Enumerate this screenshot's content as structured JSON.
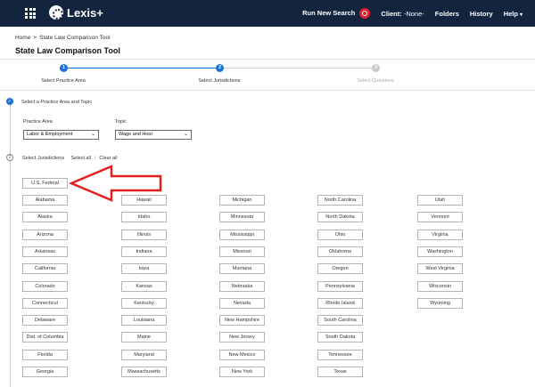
{
  "header": {
    "logo_text": "Lexis+",
    "run_search": "Run New Search",
    "client_label": "Client:",
    "client_value": "-None-",
    "folders": "Folders",
    "history": "History",
    "help": "Help"
  },
  "breadcrumb": {
    "home": "Home",
    "sep": ">",
    "current": "State Law Comparison Tool"
  },
  "page_title": "State Law Comparison Tool",
  "steps": [
    {
      "num": "1",
      "label": "Select Practice Area"
    },
    {
      "num": "2",
      "label": "Select Jurisdictions"
    },
    {
      "num": "3",
      "label": "Select Questions"
    }
  ],
  "section1": {
    "label": "Select a Practice Area and Topic",
    "practice_area_label": "Practice Area",
    "practice_area_value": "Labor & Employment",
    "topic_label": "Topic",
    "topic_value": "Wage and Hour"
  },
  "section2": {
    "label": "Select Jurisdictions",
    "select_all": "Select all",
    "pipe": "|",
    "clear_all": "Clear all",
    "num": "2"
  },
  "federal": "U.S. Federal",
  "columns": [
    [
      "Alabama",
      "Alaska",
      "Arizona",
      "Arkansas",
      "California",
      "Colorado",
      "Connecticut",
      "Delaware",
      "Dist. of Columbia",
      "Florida",
      "Georgia"
    ],
    [
      "Hawaii",
      "Idaho",
      "Illinois",
      "Indiana",
      "Iowa",
      "Kansas",
      "Kentucky",
      "Louisiana",
      "Maine",
      "Maryland",
      "Massachusetts"
    ],
    [
      "Michigan",
      "Minnesota",
      "Mississippi",
      "Missouri",
      "Montana",
      "Nebraska",
      "Nevada",
      "New Hampshire",
      "New Jersey",
      "New Mexico",
      "New York"
    ],
    [
      "North Carolina",
      "North Dakota",
      "Ohio",
      "Oklahoma",
      "Oregon",
      "Pennsylvania",
      "Rhode Island",
      "South Carolina",
      "South Dakota",
      "Tennessee",
      "Texas"
    ],
    [
      "Utah",
      "Vermont",
      "Virginia",
      "Washington",
      "West Virginia",
      "Wisconsin",
      "Wyoming"
    ]
  ],
  "colors": {
    "nav_bg": "#13243f",
    "accent_blue": "#1a73d4",
    "search_red": "#e2202c",
    "annotation_red": "#e0201e"
  }
}
